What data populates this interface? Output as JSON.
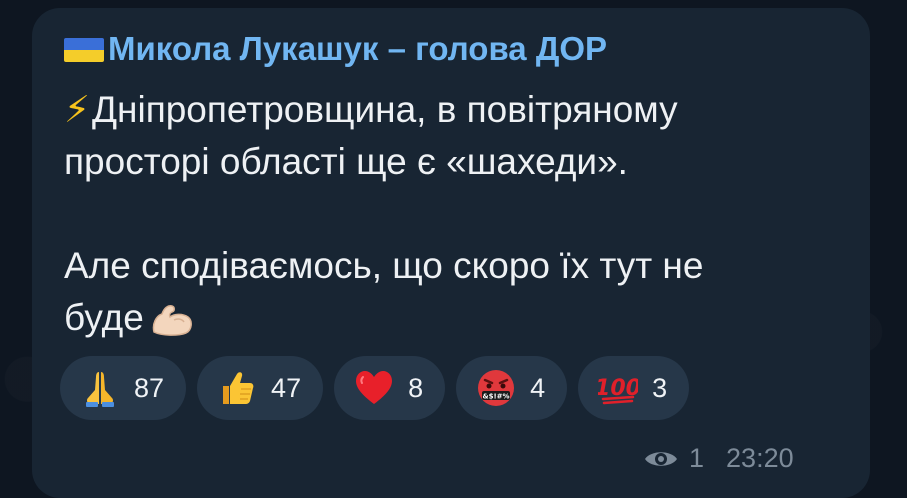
{
  "message": {
    "sender": "Микола Лукашук – голова ДОР",
    "line1": "Дніпропетровщина, в повітряному",
    "line2": "просторі області ще є «шахеди».",
    "line3": "Але сподіваємось, що скоро їх тут не",
    "line4": "буде",
    "sender_icon": "ukraine-flag-icon",
    "lead_icon": "lightning-icon",
    "trail_icon": "flexed-biceps-icon"
  },
  "reactions": [
    {
      "icon": "folded-hands-icon",
      "count": "87"
    },
    {
      "icon": "thumbs-up-icon",
      "count": "47"
    },
    {
      "icon": "red-heart-icon",
      "count": "8"
    },
    {
      "icon": "cursing-face-icon",
      "count": "4"
    },
    {
      "icon": "hundred-points-icon",
      "count": "3"
    }
  ],
  "meta": {
    "views": "1",
    "time": "23:20",
    "views_icon": "eye-icon"
  },
  "colors": {
    "background": "#0e1621",
    "bubble": "#182533",
    "sender": "#71b6f2",
    "text": "#eef1f4",
    "reaction_bg": "#263749",
    "meta": "#7d8b99"
  }
}
